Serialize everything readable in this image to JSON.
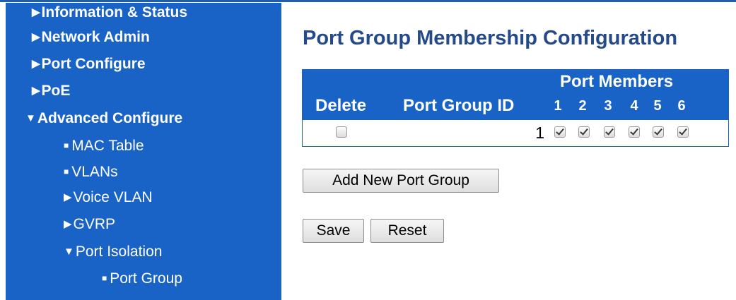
{
  "sidebar": {
    "items": [
      {
        "glyph": "▶",
        "label": "Information & Status"
      },
      {
        "glyph": "▶",
        "label": "Network Admin"
      },
      {
        "glyph": "▶",
        "label": "Port Configure"
      },
      {
        "glyph": "▶",
        "label": "PoE"
      },
      {
        "glyph": "▼",
        "label": "Advanced Configure"
      },
      {
        "glyph": "■",
        "label": "MAC Table"
      },
      {
        "glyph": "■",
        "label": "VLANs"
      },
      {
        "glyph": "▶",
        "label": "Voice VLAN"
      },
      {
        "glyph": "▶",
        "label": "GVRP"
      },
      {
        "glyph": "▼",
        "label": "Port Isolation"
      },
      {
        "glyph": "■",
        "label": "Port Group"
      }
    ]
  },
  "page": {
    "title": "Port Group Membership Configuration"
  },
  "table": {
    "headers": {
      "delete": "Delete",
      "group_id": "Port Group ID",
      "port_members": "Port Members",
      "ports": [
        "1",
        "2",
        "3",
        "4",
        "5",
        "6"
      ]
    },
    "rows": [
      {
        "delete_checked": false,
        "group_id": "1",
        "members": [
          true,
          true,
          true,
          true,
          true,
          true
        ]
      }
    ]
  },
  "buttons": {
    "add_new": "Add New Port Group",
    "save": "Save",
    "reset": "Reset"
  },
  "colors": {
    "sidebar_bg": "#1a63c6",
    "title": "#244a8a",
    "header_bg": "#1a63c6"
  }
}
